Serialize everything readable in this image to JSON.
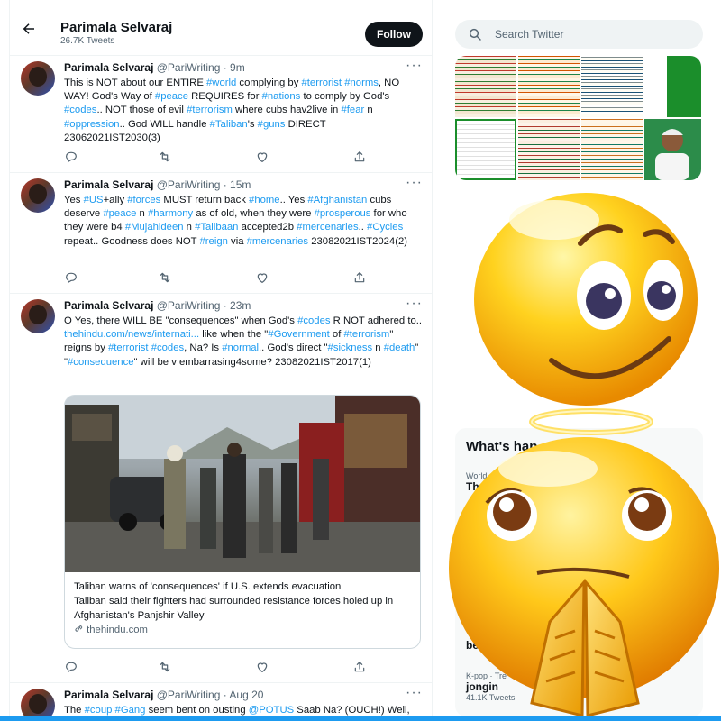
{
  "header": {
    "back_icon": "arrow-left-icon",
    "name": "Parimala Selvaraj",
    "tweet_count": "26.7K Tweets",
    "follow_label": "Follow"
  },
  "tweets": [
    {
      "name": "Parimala Selvaraj",
      "meta": "@PariWriting · 9m",
      "text_segments": [
        [
          "This is NOT about our ENTIRE ",
          false
        ],
        [
          "#world",
          true
        ],
        [
          " complying by ",
          false
        ],
        [
          "#terrorist",
          true
        ],
        [
          " ",
          false
        ],
        [
          "#norms",
          true
        ],
        [
          ", NO WAY! God's Way of ",
          false
        ],
        [
          "#peace",
          true
        ],
        [
          " REQUIRES for ",
          false
        ],
        [
          "#nations",
          true
        ],
        [
          " to comply by God's ",
          false
        ],
        [
          "#codes",
          true
        ],
        [
          ".. NOT those of evil ",
          false
        ],
        [
          "#terrorism",
          true
        ],
        [
          " where cubs hav2live in ",
          false
        ],
        [
          "#fear",
          true
        ],
        [
          " n ",
          false
        ],
        [
          "#oppression",
          true
        ],
        [
          ".. God WILL handle ",
          false
        ],
        [
          "#Taliban",
          true
        ],
        [
          "'s ",
          false
        ],
        [
          "#guns",
          true
        ],
        [
          " DIRECT 23062021IST2030(3)",
          false
        ]
      ]
    },
    {
      "name": "Parimala Selvaraj",
      "meta": "@PariWriting · 15m",
      "text_segments": [
        [
          "Yes ",
          false
        ],
        [
          "#US",
          true
        ],
        [
          "+ally ",
          false
        ],
        [
          "#forces",
          true
        ],
        [
          " MUST return back ",
          false
        ],
        [
          "#home",
          true
        ],
        [
          ".. Yes ",
          false
        ],
        [
          "#Afghanistan",
          true
        ],
        [
          " cubs deserve ",
          false
        ],
        [
          "#peace",
          true
        ],
        [
          " n ",
          false
        ],
        [
          "#harmony",
          true
        ],
        [
          " as of old, when they were ",
          false
        ],
        [
          "#prosperous",
          true
        ],
        [
          " for who they were b4 ",
          false
        ],
        [
          "#Mujahideen",
          true
        ],
        [
          " n ",
          false
        ],
        [
          "#Talibaan",
          true
        ],
        [
          " accepted2b ",
          false
        ],
        [
          "#mercenaries",
          true
        ],
        [
          ".. ",
          false
        ],
        [
          "#Cycles",
          true
        ],
        [
          " repeat.. Goodness does NOT ",
          false
        ],
        [
          "#reign",
          true
        ],
        [
          " via ",
          false
        ],
        [
          "#mercenaries",
          true
        ],
        [
          " 23082021IST2024(2)",
          false
        ]
      ]
    },
    {
      "name": "Parimala Selvaraj",
      "meta": "@PariWriting · 23m",
      "text_segments": [
        [
          "O Yes, there WILL BE \"consequences\" when God's ",
          false
        ],
        [
          "#codes",
          true
        ],
        [
          " R NOT adhered to.. ",
          false
        ],
        [
          "thehindu.com/news/internati...",
          true
        ],
        [
          " like when the \"",
          false
        ],
        [
          "#Government",
          true
        ],
        [
          " of ",
          false
        ],
        [
          "#terrorism",
          true
        ],
        [
          "\" reigns by ",
          false
        ],
        [
          "#terrorist",
          true
        ],
        [
          " ",
          false
        ],
        [
          "#codes",
          true
        ],
        [
          ", Na? Is ",
          false
        ],
        [
          "#normal",
          true
        ],
        [
          ".. God's direct \"",
          false
        ],
        [
          "#sickness",
          true
        ],
        [
          " n ",
          false
        ],
        [
          "#death",
          true
        ],
        [
          "\" \"",
          false
        ],
        [
          "#consequence",
          true
        ],
        [
          "\" will be v embarrasing4some? 23082021IST2017(1)",
          false
        ]
      ],
      "card": {
        "title": "Taliban warns of 'consequences' if U.S. extends evacuation",
        "description": "Taliban said their fighters had surrounded resistance forces holed up in Afghanistan's Panjshir Valley",
        "domain": "thehindu.com"
      }
    },
    {
      "name": "Parimala Selvaraj",
      "meta": "@PariWriting · Aug 20",
      "text_segments": [
        [
          "The ",
          false
        ],
        [
          "#coup",
          true
        ],
        [
          " ",
          false
        ],
        [
          "#Gang",
          true
        ],
        [
          " seem bent on ousting ",
          false
        ],
        [
          "@POTUS",
          true
        ],
        [
          " Saab Na? (OUCH!) Well,",
          false
        ]
      ]
    }
  ],
  "actions": {
    "reply_icon": "reply-icon",
    "retweet_icon": "retweet-icon",
    "like_icon": "heart-icon",
    "share_icon": "share-icon",
    "more_icon": "more-icon",
    "more_label": "···"
  },
  "search": {
    "placeholder": "Search Twitter",
    "icon": "search-icon"
  },
  "trends": {
    "title": "What's hap",
    "items": [
      {
        "category": "World",
        "name": "Th"
      },
      {
        "category": "",
        "name": "be"
      },
      {
        "category": "K-pop · Tre",
        "name": "jongin",
        "count": "41.1K Tweets"
      }
    ]
  },
  "colors": {
    "accent": "#1d9bf0",
    "text": "#0f1419",
    "secondary": "#536471"
  }
}
